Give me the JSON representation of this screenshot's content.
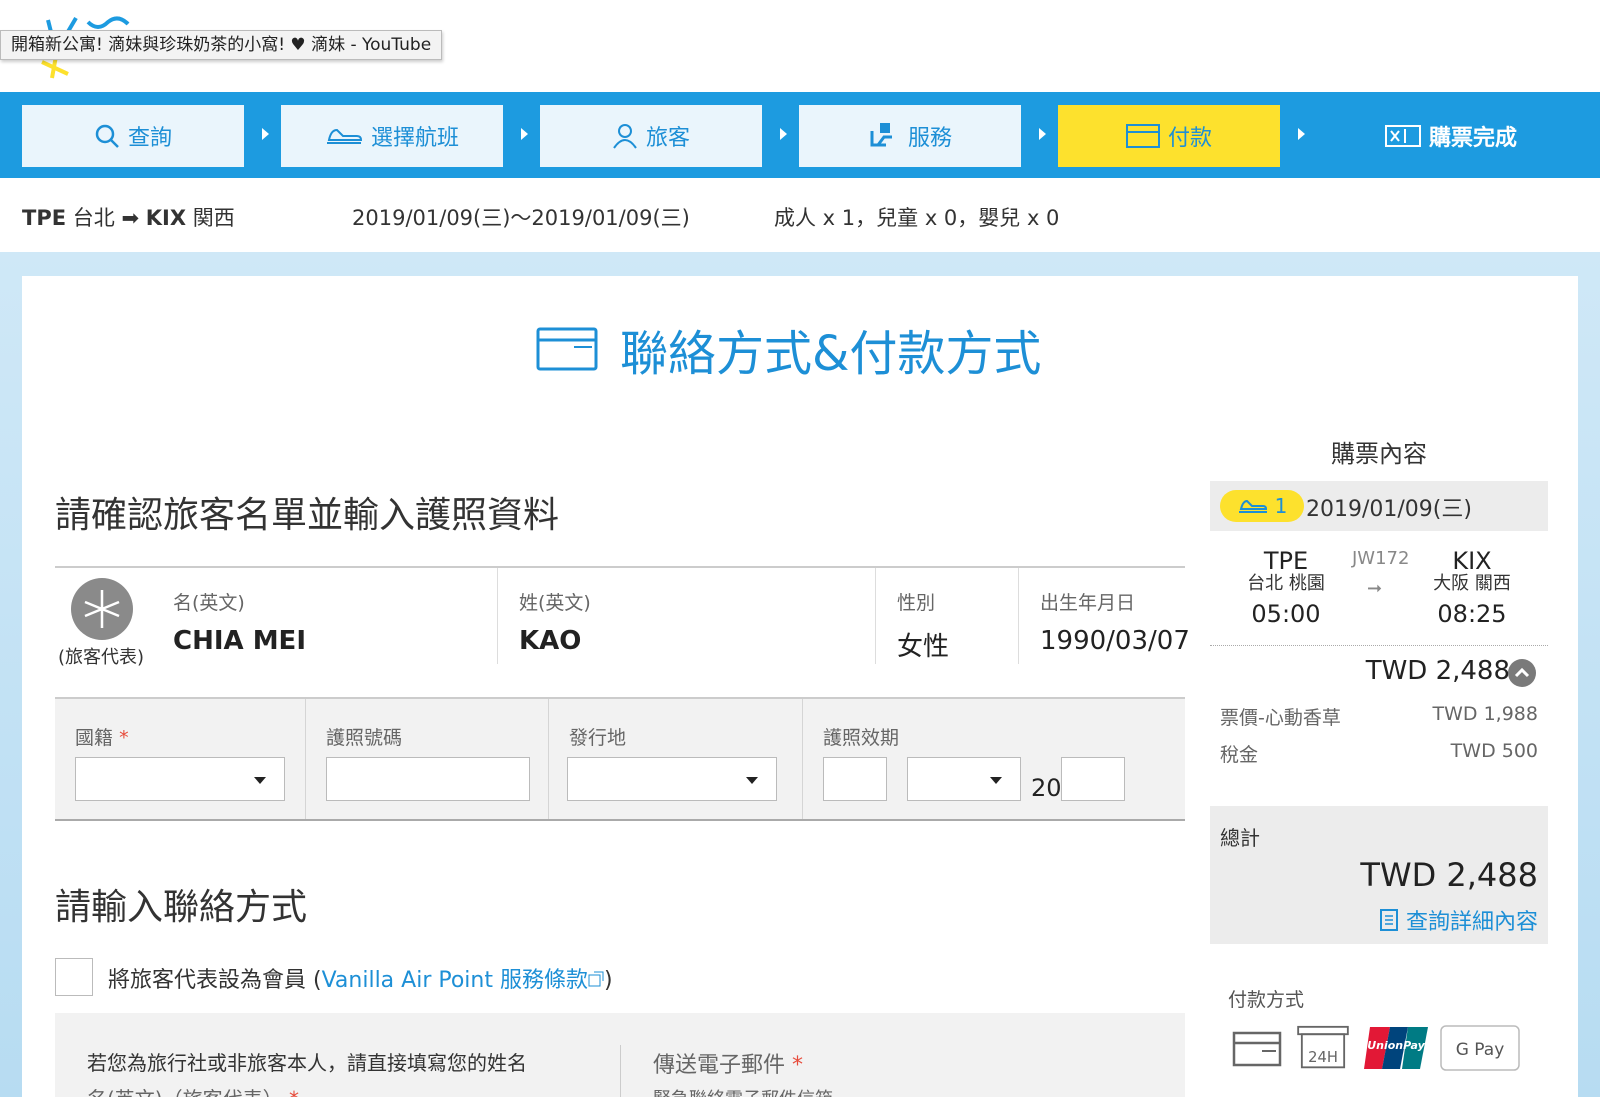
{
  "tooltip": "開箱新公寓! 滴妹與珍珠奶茶的小窩! ♥ 滴妹 - YouTube",
  "steps": [
    {
      "label": "查詢",
      "icon": "search-icon"
    },
    {
      "label": "選擇航班",
      "icon": "plane-icon"
    },
    {
      "label": "旅客",
      "icon": "person-icon"
    },
    {
      "label": "服務",
      "icon": "seat-icon"
    },
    {
      "label": "付款",
      "icon": "credit-card-icon"
    },
    {
      "label": "購票完成",
      "icon": "ticket-icon"
    }
  ],
  "route": {
    "from_code": "TPE",
    "from_city": "台北",
    "to_code": "KIX",
    "to_city": "関西",
    "dates": "2019/01/09(三)～2019/01/09(三)",
    "passengers": "成人 x 1，兒童 x 0，嬰兒 x 0"
  },
  "page_title": "聯絡方式&付款方式",
  "passenger_section": {
    "title": "請確認旅客名單並輸入護照資料",
    "representative_label": "(旅客代表)",
    "first_name_label": "名(英文)",
    "first_name": "CHIA MEI",
    "last_name_label": "姓(英文)",
    "last_name": "KAO",
    "gender_label": "性別",
    "gender": "女性",
    "dob_label": "出生年月日",
    "dob": "1990/03/07",
    "nationality_label": "國籍",
    "passport_no_label": "護照號碼",
    "issue_place_label": "發行地",
    "expiry_label": "護照效期",
    "year_prefix": "20",
    "required_mark": "*"
  },
  "contact_section": {
    "title": "請輸入聯絡方式",
    "member_checkbox_label": "將旅客代表設為會員 (",
    "member_link": "Vanilla Air Point 服務條款",
    "member_checkbox_suffix": ")",
    "agent_note": "若您為旅行社或非旅客本人，請直接填寫您的姓名",
    "name_label": "名(英文)（旅客代表）",
    "email_label": "傳送電子郵件",
    "email_sub_label": "緊急聯絡電子郵件信箱"
  },
  "sidebar": {
    "title": "購票內容",
    "segment_no": "1",
    "date": "2019/01/09(三)",
    "origin": {
      "code": "TPE",
      "city": "台北 桃園",
      "time": "05:00"
    },
    "flight_no": "JW172",
    "arrow": "➞",
    "destination": {
      "code": "KIX",
      "city": "大阪 關西",
      "time": "08:25"
    },
    "subtotal": "TWD 2,488",
    "fare_label": "票價-心動香草",
    "fare": "TWD 1,988",
    "tax_label": "稅金",
    "tax": "TWD 500",
    "total_label": "總計",
    "total": "TWD 2,488",
    "details_link": "查詢詳細內容",
    "payment_title": "付款方式",
    "payment_methods": [
      "credit-card",
      "24H",
      "UnionPay",
      "G Pay"
    ]
  },
  "colors": {
    "brand_blue": "#1d9be0",
    "accent_yellow": "#fde12d",
    "required_red": "#e74c3c"
  }
}
